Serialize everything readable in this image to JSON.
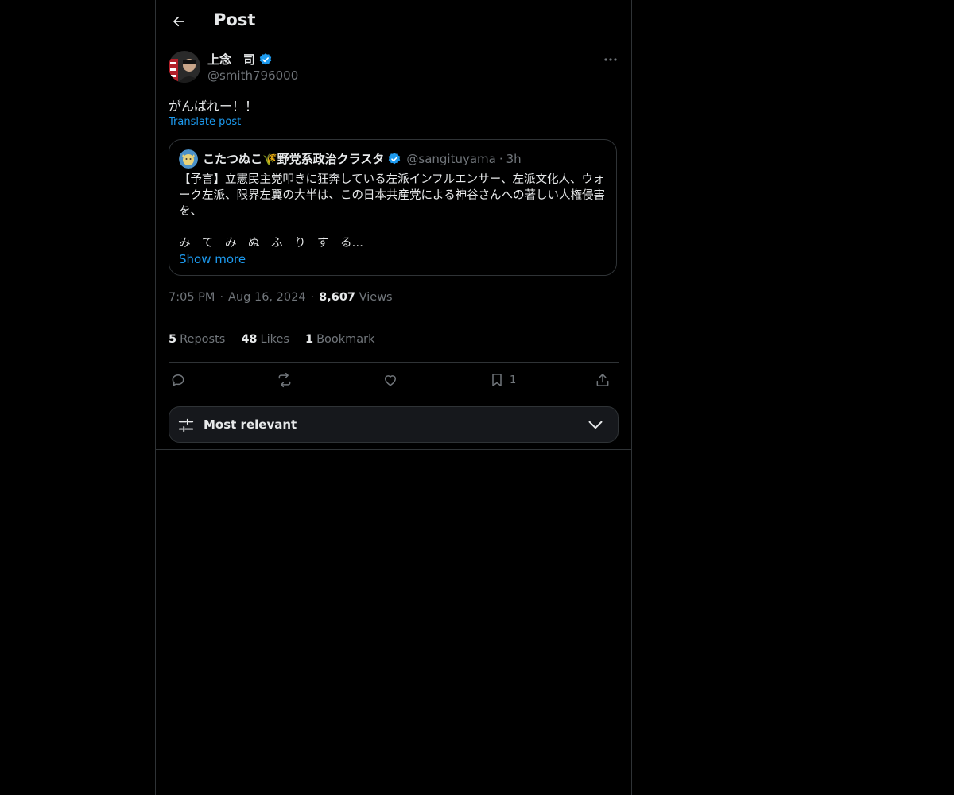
{
  "header": {
    "title": "Post"
  },
  "post": {
    "author_name": "上念　司",
    "author_handle": "@smith796000",
    "text": "がんばれー！！",
    "translate_label": "Translate post",
    "time": "7:05 PM",
    "date": "Aug 16, 2024",
    "views_count": "8,607",
    "views_label": "Views"
  },
  "quote": {
    "author_name": "こたつぬこ🌾野党系政治クラスタ",
    "author_handle": "@sangituyama",
    "time": "3h",
    "body": "【予言】立憲民主党叩きに狂奔している左派インフルエンサー、左派文化人、ウォーク左派、限界左翼の大半は、この日本共産党による神谷さんへの著しい人権侵害を、\n\nみ　て　み　ぬ　ふ　り　す　る…",
    "show_more": "Show more"
  },
  "stats": {
    "reposts_count": "5",
    "reposts_label": "Reposts",
    "likes_count": "48",
    "likes_label": "Likes",
    "bookmarks_count": "1",
    "bookmarks_label": "Bookmark"
  },
  "actions": {
    "bookmark_count": "1"
  },
  "sort": {
    "label": "Most relevant"
  },
  "colors": {
    "accent": "#1d9bf0",
    "background": "#000000",
    "muted": "#71767b",
    "border": "#2f3336"
  }
}
